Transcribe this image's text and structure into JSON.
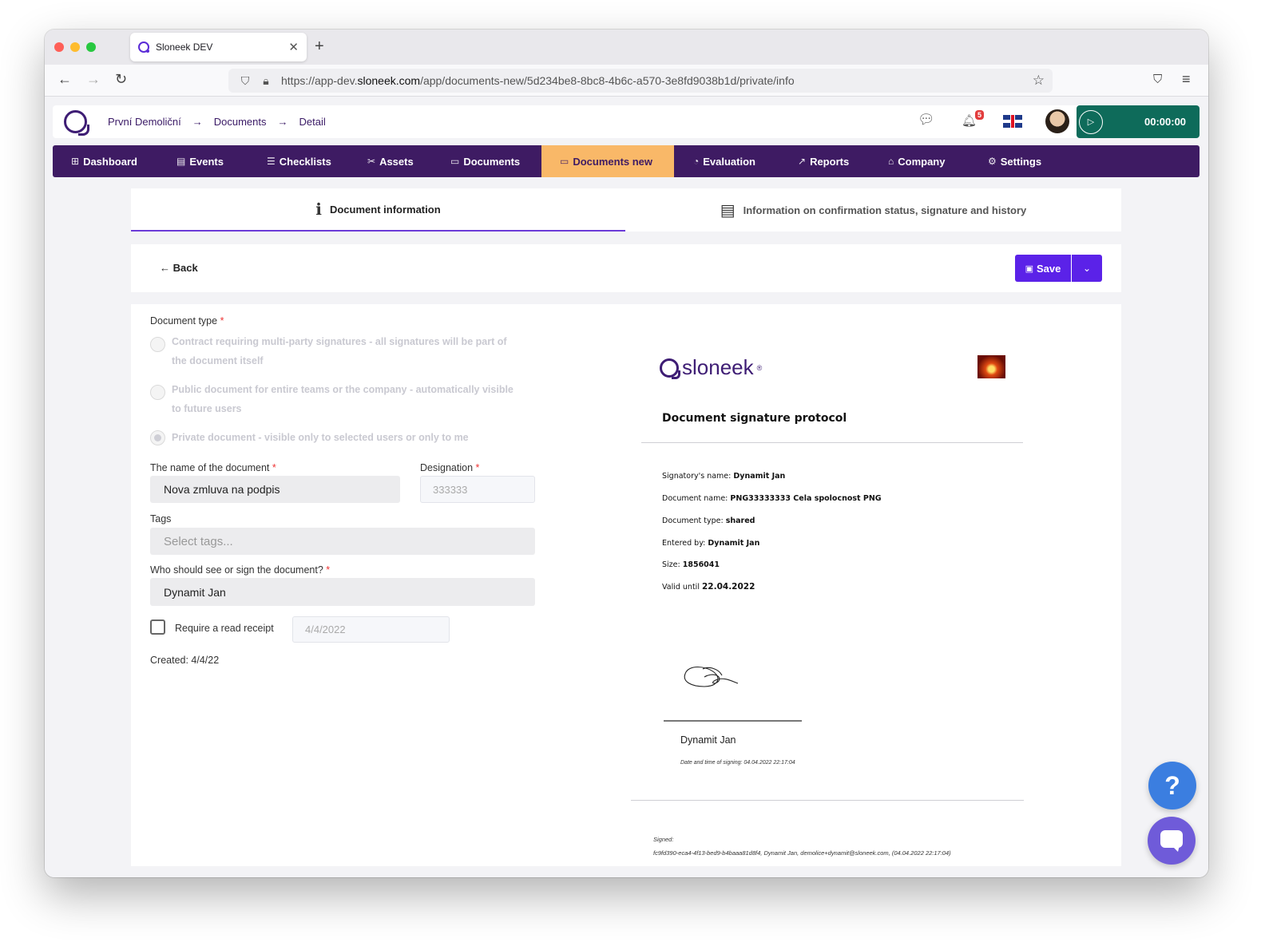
{
  "browser": {
    "tab_title": "Sloneek DEV",
    "tab_close": "✕",
    "new_tab": "+",
    "url_prefix": "https://app-dev.",
    "url_domain": "sloneek.com",
    "url_path": "/app/documents-new/5d234be8-8bc8-4b6c-a570-3e8fd9038b1d/private/info"
  },
  "header": {
    "breadcrumb": [
      "První Demoliční",
      "Documents",
      "Detail"
    ],
    "breadcrumb_sep": "→",
    "notification_count": "5",
    "timer": "00:00:00"
  },
  "menu": [
    {
      "icon": "⊞",
      "label": "Dashboard"
    },
    {
      "icon": "▤",
      "label": "Events"
    },
    {
      "icon": "☰",
      "label": "Checklists"
    },
    {
      "icon": "✂",
      "label": "Assets"
    },
    {
      "icon": "▭",
      "label": "Documents"
    },
    {
      "icon": "▭",
      "label": "Documents new",
      "active": true
    },
    {
      "icon": "◔",
      "label": "Evaluation"
    },
    {
      "icon": "↗",
      "label": "Reports"
    },
    {
      "icon": "⌂",
      "label": "Company"
    },
    {
      "icon": "⚙",
      "label": "Settings"
    }
  ],
  "tabs": {
    "info": "Document information",
    "status": "Information on confirmation status, signature and history"
  },
  "toolbar": {
    "back": "Back",
    "save": "Save"
  },
  "form": {
    "doc_type_label": "Document type",
    "required_mark": "*",
    "doc_types": [
      "Contract requiring multi-party signatures - all signatures will be part of the document itself",
      "Public document for entire teams or the company - automatically visible to future users",
      "Private document - visible only to selected users or only to me"
    ],
    "selected_doc_type": 2,
    "name_label": "The name of the document",
    "name_value": "Nova zmluva na podpis",
    "designation_label": "Designation",
    "designation_value": "333333",
    "tags_label": "Tags",
    "tags_placeholder": "Select tags...",
    "who_label": "Who should see or sign the document?",
    "who_value": "Dynamit Jan",
    "read_receipt_label": "Require a read receipt",
    "read_receipt_checked": false,
    "read_receipt_date": "4/4/2022",
    "created": "Created: 4/4/22"
  },
  "preview": {
    "logo_text": "sloneek",
    "logo_mark": "®",
    "title": "Document signature protocol",
    "fields": [
      {
        "label": "Signatory's name: ",
        "value": "Dynamit Jan"
      },
      {
        "label": "Document name: ",
        "value": "PNG33333333 Cela spolocnost PNG"
      },
      {
        "label": "Document type: ",
        "value": "shared"
      },
      {
        "label": "Entered by: ",
        "value": "Dynamit Jan"
      },
      {
        "label": "Size: ",
        "value": "1856041"
      },
      {
        "label": "Valid until ",
        "value": "22.04.2022"
      }
    ],
    "signer_name": "Dynamit Jan",
    "signing_datetime": "Date and time of signing: 04.04.2022 22:17:04",
    "signed_label": "Signed:",
    "signed_hash": "fc9fd390-eca4-4f13-bed9-b4baaa81d8f4, Dynamit Jan, demolice+dynamit@sloneek.com, (04.04.2022 22:17:04)"
  },
  "widgets": {
    "help": "?"
  },
  "colors": {
    "menu_bg": "#3e1b63",
    "menu_active": "#f9b868",
    "primary": "#5b22e8",
    "timer_bg": "#0e6b5a"
  }
}
